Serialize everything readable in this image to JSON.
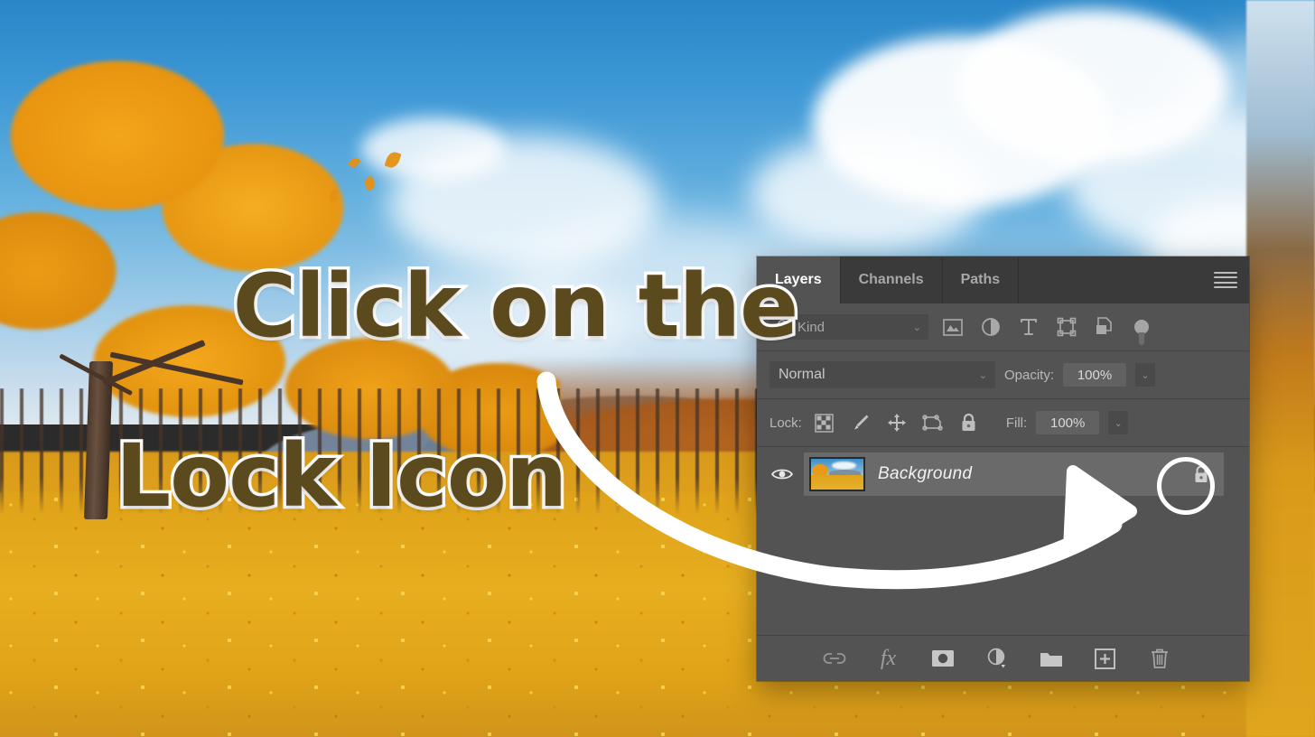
{
  "overlay": {
    "headline_line1": "Click on the",
    "headline_line2": "Lock Icon",
    "headline_color": "#5b4a1d",
    "headline_outline_color": "#ffffff",
    "arrow_color": "#ffffff",
    "highlight_ring_color": "#ffffff",
    "highlight_target": "layer-lock-icon"
  },
  "panel": {
    "title": "Layers",
    "tabs": [
      {
        "label": "Layers",
        "active": true
      },
      {
        "label": "Channels",
        "active": false
      },
      {
        "label": "Paths",
        "active": false
      }
    ],
    "menu_icon": "hamburger-menu-icon",
    "filter_bar": {
      "kind_label": "Kind",
      "kind_caret": "⌄",
      "icons": [
        "pixel-layer-filter-icon",
        "adjustment-layer-filter-icon",
        "type-layer-filter-icon",
        "shape-layer-filter-icon",
        "smart-object-filter-icon"
      ],
      "toggle": "filter-enable-toggle"
    },
    "mode_bar": {
      "blend_mode": "Normal",
      "blend_caret": "⌄",
      "opacity_label": "Opacity:",
      "opacity_value": "100%",
      "opacity_caret": "⌄"
    },
    "lock_bar": {
      "label": "Lock:",
      "icons": [
        "lock-transparent-pixels-icon",
        "lock-image-pixels-icon",
        "lock-position-icon",
        "lock-artboard-nesting-icon",
        "lock-all-icon"
      ],
      "fill_label": "Fill:",
      "fill_value": "100%",
      "fill_caret": "⌄"
    },
    "layers": [
      {
        "name": "Background",
        "visible": true,
        "locked": true,
        "selected": true,
        "visibility_icon": "eye-icon",
        "lock_icon": "lock-icon",
        "thumbnail": "autumn-landscape-thumbnail"
      }
    ],
    "bottom_bar": {
      "icons": [
        "link-layers-icon",
        "layer-style-fx-icon",
        "add-layer-mask-icon",
        "new-adjustment-layer-icon",
        "new-group-icon",
        "new-layer-icon",
        "delete-layer-icon"
      ],
      "fx_label": "fx"
    },
    "colors": {
      "panel_bg": "#535353",
      "tabbar_bg": "#3a3a3a",
      "row_selected_bg": "#6a6a6a",
      "field_bg": "#4a4a4a",
      "text": "#cfcfcf"
    }
  },
  "background_photo": {
    "description": "autumn-landscape-photo",
    "sky_color": "#3f99d6",
    "foliage_color": "#e89410",
    "field_color": "#e0a31c"
  }
}
